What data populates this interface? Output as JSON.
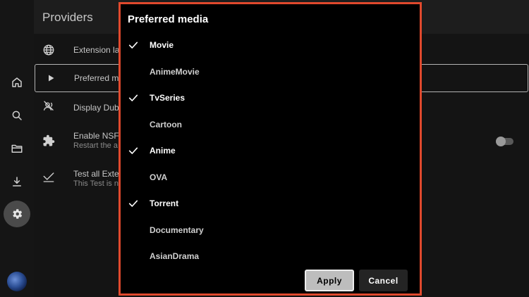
{
  "page": {
    "title": "Providers",
    "settings": [
      {
        "title": "Extension la",
        "subtitle": "",
        "icon": "globe-icon"
      },
      {
        "title": "Preferred m",
        "subtitle": "",
        "icon": "play-icon"
      },
      {
        "title": "Display Dub",
        "subtitle": "",
        "icon": "voice-off-icon"
      },
      {
        "title": "Enable NSF",
        "subtitle": "Restart the a",
        "icon": "extension-puzzle-icon"
      },
      {
        "title": "Test all Exte",
        "subtitle": "This Test is n",
        "icon": "check-down-icon"
      }
    ]
  },
  "nav": {
    "items": [
      "home-icon",
      "search-icon",
      "folder-icon",
      "download-icon",
      "settings-icon"
    ],
    "active": "settings-icon"
  },
  "dialog": {
    "title": "Preferred media",
    "options": [
      {
        "label": "Movie",
        "checked": true
      },
      {
        "label": "AnimeMovie",
        "checked": false
      },
      {
        "label": "TvSeries",
        "checked": true
      },
      {
        "label": "Cartoon",
        "checked": false
      },
      {
        "label": "Anime",
        "checked": true
      },
      {
        "label": "OVA",
        "checked": false
      },
      {
        "label": "Torrent",
        "checked": true
      },
      {
        "label": "Documentary",
        "checked": false
      },
      {
        "label": "AsianDrama",
        "checked": false
      }
    ],
    "apply_label": "Apply",
    "cancel_label": "Cancel"
  },
  "colors": {
    "highlight_border": "#e0492d",
    "background": "#000000",
    "page_background": "#141414"
  }
}
